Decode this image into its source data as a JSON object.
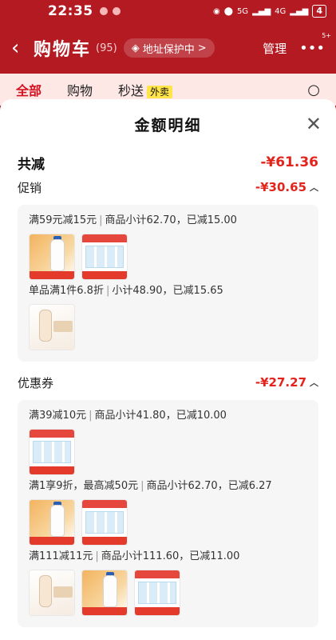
{
  "status": {
    "time": "22:35",
    "network": "5G",
    "network2": "4G",
    "battery": "4"
  },
  "header": {
    "title": "购物车",
    "count": "(95)",
    "address_label": "地址保护中",
    "address_arrow": ">",
    "manage": "管理",
    "more_badge": "5+"
  },
  "tabs": [
    {
      "label": "全部"
    },
    {
      "label": "购物"
    },
    {
      "label": "秒送"
    }
  ],
  "tab_tag": "外卖",
  "sheet": {
    "title": "金额明细",
    "total_label": "共减",
    "total_value": "-¥61.36",
    "sections": [
      {
        "label": "促销",
        "value": "-¥30.65",
        "groups": [
          {
            "rule": "满59元减15元",
            "detail": "商品小计62.70，已减15.00",
            "thumbs": [
              "milk",
              "box"
            ]
          },
          {
            "rule": "单品满1件6.8折",
            "detail": "小计48.90，已减15.65",
            "thumbs": [
              "dove"
            ]
          }
        ]
      },
      {
        "label": "优惠券",
        "value": "-¥27.27",
        "groups": [
          {
            "rule": "满39减10元",
            "detail": "商品小计41.80，已减10.00",
            "thumbs": [
              "box"
            ]
          },
          {
            "rule": "满1享9折，最高减50元",
            "detail": "商品小计62.70，已减6.27",
            "thumbs": [
              "milk",
              "box"
            ]
          },
          {
            "rule": "满111减11元",
            "detail": "商品小计111.60，已减11.00",
            "thumbs": [
              "dove",
              "milk",
              "box"
            ]
          }
        ]
      }
    ]
  },
  "colors": {
    "brand_red": "#b41a22",
    "discount_red": "#e3241d",
    "tag_yellow": "#ffe44a"
  }
}
